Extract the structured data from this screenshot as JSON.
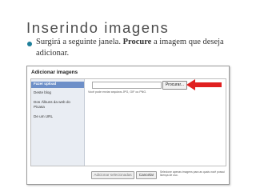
{
  "slide": {
    "title": "Inserindo imagens",
    "bullet_before": "Surgirá a seguinte janela. ",
    "bullet_bold": "Procure",
    "bullet_after": " a imagem que deseja adicionar."
  },
  "dialog": {
    "title": "Adicionar imagens",
    "sidebar": [
      {
        "label": "Fazer upload"
      },
      {
        "label": "Deste blog"
      },
      {
        "label": "Dos Álbuns da web do Picasa"
      },
      {
        "label": "De um URL"
      }
    ],
    "browse_label": "Procurar...",
    "hint": "Você pode enviar arquivos JPG, GIF ou PNG.",
    "add_label": "Adicionar selecionadas",
    "cancel_label": "Cancelar",
    "footer_note": "Selecione apenas imagens para as quais você possui licença de uso."
  },
  "colors": {
    "accent_arrow": "#e02020",
    "bullet": "#1f7f9a",
    "sidebar_active": "#6d8fc8"
  }
}
